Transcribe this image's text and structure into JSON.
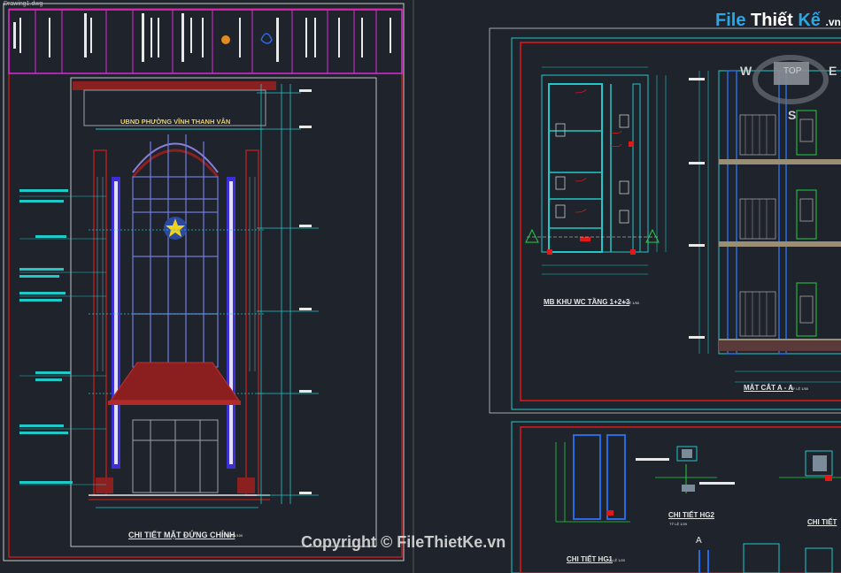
{
  "app": {
    "tab_label": "Drawing1.dwg"
  },
  "left_sheet": {
    "header_text": "UBND PHƯỜNG VĨNH THANH VÂN",
    "drawing_title": "CHI TIẾT MẶT ĐỨNG CHÍNH",
    "drawing_scale": "TỶ LỆ 1/100"
  },
  "right_sheet": {
    "plan_title": "MB KHU WC TẦNG 1+2+3",
    "plan_scale": "TỶ LỆ 1/50",
    "section_title": "MẶT CẮT A - A",
    "section_scale": "TỶ LỆ 1/50",
    "detail_hg2_title": "CHI TIẾT HG2",
    "detail_hg2_scale": "TỶ LỆ 1/20",
    "detail_hg1_title": "CHI TIẾT HG1",
    "detail_hg1_scale": "TỶ LỆ 1/20",
    "detail_right_title": "CHI TIẾT",
    "section_marker": "A"
  },
  "viewcube": {
    "top": "TOP",
    "west": "W",
    "east": "E",
    "south": "S"
  },
  "watermarks": {
    "logo_file": "File",
    "logo_thiet": "Thiết",
    "logo_ke": "Kế",
    "logo_vn": ".vn",
    "copyright": "Copyright © FileThietKe.vn"
  },
  "colors": {
    "background": "#1f232b",
    "frame_red": "#e01a1a",
    "frame_cyan": "#20c8c8",
    "title_magenta": "#d82bd8"
  }
}
